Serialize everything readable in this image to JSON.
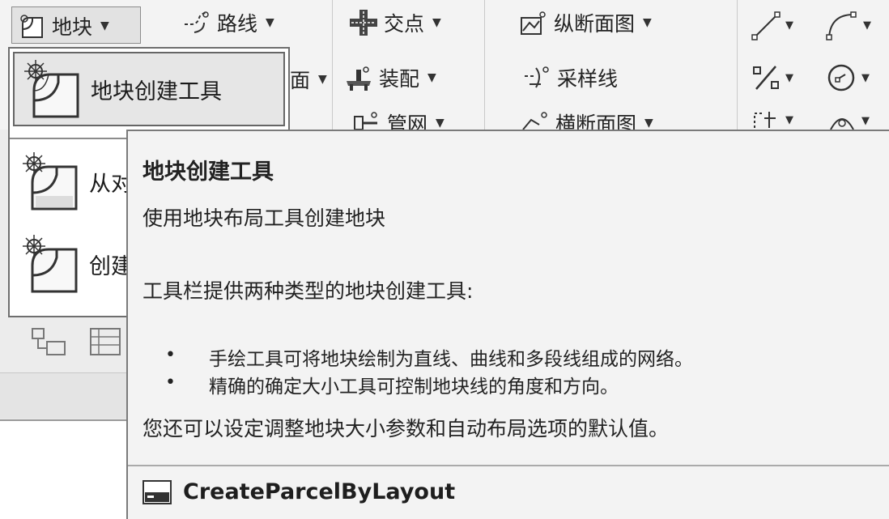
{
  "ribbon": {
    "parcel_menu_label": "地块",
    "items": {
      "alignment": "路线",
      "profile_partial": "面",
      "intersection": "交点",
      "assembly": "装配",
      "pipe_network": "管网",
      "profile_view": "纵断面图",
      "sample_lines": "采样线",
      "section_views": "横断面图"
    }
  },
  "parcel_menu": {
    "items": [
      {
        "label": "地块创建工具"
      },
      {
        "label": "从对"
      },
      {
        "label": "创建"
      }
    ]
  },
  "tooltip": {
    "title": "地块创建工具",
    "description": "使用地块布局工具创建地块",
    "intro": "工具栏提供两种类型的地块创建工具:",
    "bullets": [
      "手绘工具可将地块绘制为直线、曲线和多段线组成的网络。",
      "精确的确定大小工具可控制地块线的角度和方向。"
    ],
    "footer_note": "您还可以设定调整地块大小参数和自动布局选项的默认值。",
    "command": "CreateParcelByLayout"
  },
  "icons": {
    "parcel": "parcel-tool-icon",
    "alignment": "alignment-icon",
    "intersection": "intersection-icon",
    "assembly": "assembly-icon",
    "pipe_network": "pipe-network-icon",
    "profile_view": "profile-view-icon",
    "sample_lines": "sample-lines-icon",
    "section_views": "section-views-icon",
    "line": "draw-line-icon",
    "curve": "draw-curve-icon",
    "percent": "grade-icon",
    "circle": "circle-icon",
    "command": "command-line-icon"
  }
}
